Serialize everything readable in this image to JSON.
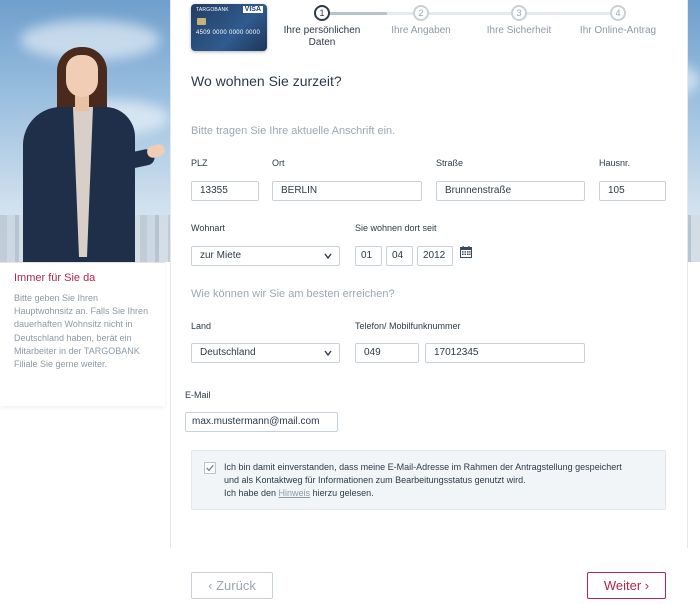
{
  "steps": [
    {
      "number": "1",
      "label_line1": "Ihre persönlichen",
      "label_line2": "Daten"
    },
    {
      "number": "2",
      "label_line1": "Ihre Angaben",
      "label_line2": ""
    },
    {
      "number": "3",
      "label_line1": "Ihre Sicherheit",
      "label_line2": ""
    },
    {
      "number": "4",
      "label_line1": "Ihr Online-Antrag",
      "label_line2": ""
    }
  ],
  "card": {
    "brand": "TARGOBANK",
    "network": "VISA",
    "number": "4509 0000 0000 0000"
  },
  "info": {
    "title": "Immer für Sie da",
    "text": "Bitte geben Sie Ihren Hauptwohnsitz an. Falls Sie Ihren dauerhaften Wohnsitz nicht in Deutschland haben, berät ein Mitarbeiter in der TARGOBANK Filiale Sie gerne weiter."
  },
  "form": {
    "title": "Wo wohnen Sie zurzeit?",
    "address_hint": "Bitte tragen Sie Ihre aktuelle Anschrift ein.",
    "plz_label": "PLZ",
    "plz_value": "13355",
    "ort_label": "Ort",
    "ort_value": "BERLIN",
    "strasse_label": "Straße",
    "strasse_value": "Brunnenstraße",
    "hausnr_label": "Hausnr.",
    "hausnr_value": "105",
    "wohnart_label": "Wohnart",
    "wohnart_value": "zur Miete",
    "seit_label": "Sie wohnen dort seit",
    "seit_day": "01",
    "seit_month": "04",
    "seit_year": "2012",
    "contact_hint": "Wie können wir Sie am besten erreichen?",
    "land_label": "Land",
    "land_value": "Deutschland",
    "telefon_label": "Telefon/ Mobilfunknummer",
    "telefon_prefix": "049",
    "telefon_number": "17012345",
    "email_label": "E-Mail",
    "email_value": "max.mustermann@mail.com"
  },
  "consent": {
    "line1": "Ich bin damit einverstanden, dass meine E-Mail-Adresse im Rahmen der Antragstellung gespeichert",
    "line2": "und als Kontaktweg für Informationen zum Bearbeitungsstatus genutzt wird.",
    "line3_prefix": "Ich habe den ",
    "line3_link": "Hinweis",
    "line3_suffix": " hierzu gelesen.",
    "checked": true
  },
  "buttons": {
    "back": "‹ Zurück",
    "next": "Weiter ›"
  },
  "colors": {
    "accent": "#b1264a",
    "text": "#2b3a4a",
    "muted": "#9aa8b5"
  }
}
